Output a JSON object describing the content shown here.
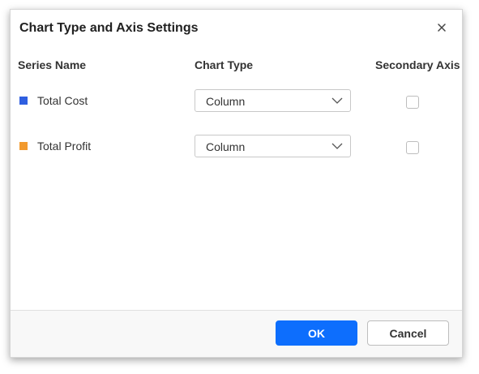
{
  "dialog": {
    "title": "Chart Type and Axis Settings",
    "close_icon": "close-icon"
  },
  "columns": {
    "series_name": "Series Name",
    "chart_type": "Chart Type",
    "secondary_axis": "Secondary Axis"
  },
  "rows": [
    {
      "series": "Total Cost",
      "color": "#2f5fe0",
      "chart_type": "Column",
      "secondary_axis": false
    },
    {
      "series": "Total Profit",
      "color": "#f29a2e",
      "chart_type": "Column",
      "secondary_axis": false
    }
  ],
  "footer": {
    "ok_label": "OK",
    "cancel_label": "Cancel"
  },
  "colors": {
    "primary": "#0d6efd"
  }
}
